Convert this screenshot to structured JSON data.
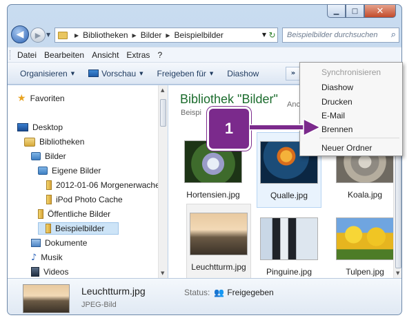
{
  "window": {
    "caption": {
      "minimize": "▁",
      "maximize": "□",
      "close": "✕"
    }
  },
  "address_bar": {
    "crumbs": [
      "Bibliotheken",
      "Bilder",
      "Beispielbilder"
    ],
    "search_placeholder": "Beispielbilder durchsuchen"
  },
  "menubar": {
    "items": [
      "Datei",
      "Bearbeiten",
      "Ansicht",
      "Extras",
      "?"
    ]
  },
  "commandbar": {
    "organize": "Organisieren",
    "preview": "Vorschau",
    "share": "Freigeben für",
    "slideshow": "Diashow",
    "more": "»"
  },
  "navpane": {
    "favorites": "Favoriten",
    "desktop": "Desktop",
    "libraries": "Bibliotheken",
    "pictures": "Bilder",
    "my_pictures": "Eigene Bilder",
    "folder_morning": "2012-01-06 Morgenerwache",
    "folder_ipod": "iPod Photo Cache",
    "public_pictures": "Öffentliche Bilder",
    "sample_pictures": "Beispielbilder",
    "documents": "Dokumente",
    "music": "Musik",
    "videos": "Videos"
  },
  "content": {
    "library_title": "Bibliothek \"Bilder\"",
    "library_sub": "Beispi",
    "arrange_label": "Anc",
    "files": [
      {
        "name": "Hortensien.jpg",
        "icon": "hydrangea-photo"
      },
      {
        "name": "Qualle.jpg",
        "icon": "jellyfish-photo"
      },
      {
        "name": "Koala.jpg",
        "icon": "koala-photo"
      },
      {
        "name": "Leuchtturm.jpg",
        "icon": "lighthouse-photo"
      },
      {
        "name": "Pinguine.jpg",
        "icon": "penguins-photo"
      },
      {
        "name": "Tulpen.jpg",
        "icon": "tulips-photo"
      }
    ]
  },
  "details": {
    "name": "Leuchtturm.jpg",
    "type": "JPEG-Bild",
    "status_label": "Status:",
    "status_value": "Freigegeben"
  },
  "dropdown": {
    "items": [
      "Synchronisieren",
      "Diashow",
      "Drucken",
      "E-Mail",
      "Brennen",
      "Neuer Ordner"
    ]
  },
  "callout": {
    "number": "1",
    "color": "#7b2a8c"
  }
}
